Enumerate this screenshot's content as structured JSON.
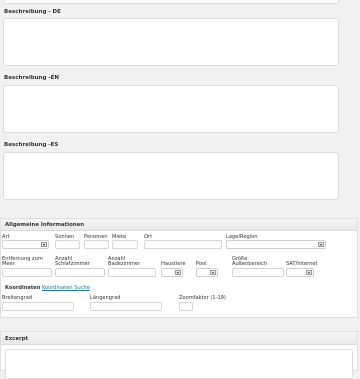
{
  "descriptions": {
    "de": {
      "label": "Beschreibung - DE"
    },
    "en": {
      "label": "Beschreibung -EN"
    },
    "es": {
      "label": "Beschreibung -ES"
    }
  },
  "general": {
    "title": "Allgemeine Informationen",
    "fields": {
      "art": "Art",
      "sonnen": "Sonnen",
      "personen": "Personen",
      "miete": "Miete",
      "ort": "Ort",
      "lage": "Lage/Region",
      "entfernung": "Entfernung zum Meer",
      "schlafzimmer": "Anzahl Schlafzimmer",
      "badezimmer": "Anzahl Badezimmer",
      "haustiere": "Haustiere",
      "pool": "Pool",
      "groesse": "Größe Außenbereich",
      "sat": "SAT/Internet"
    },
    "coordinates": {
      "label": "Koordinaten",
      "search_link": "Koordinaten Suche",
      "breitengrad": "Breitengrad",
      "laengengrad": "Längengrad",
      "zoom": "Zoomfaktor (1-19)"
    }
  },
  "excerpt": {
    "title": "Excerpt"
  }
}
